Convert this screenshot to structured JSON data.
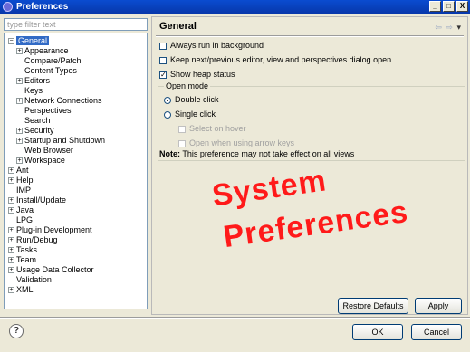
{
  "window": {
    "title": "Preferences",
    "minimize": "_",
    "maximize": "□",
    "close": "X"
  },
  "filter": {
    "placeholder": "type filter text"
  },
  "tree": {
    "expander": "+",
    "collapser": "−",
    "items": [
      {
        "label": "General"
      },
      {
        "label": "Appearance"
      },
      {
        "label": "Compare/Patch"
      },
      {
        "label": "Content Types"
      },
      {
        "label": "Editors"
      },
      {
        "label": "Keys"
      },
      {
        "label": "Network Connections"
      },
      {
        "label": "Perspectives"
      },
      {
        "label": "Search"
      },
      {
        "label": "Security"
      },
      {
        "label": "Startup and Shutdown"
      },
      {
        "label": "Web Browser"
      },
      {
        "label": "Workspace"
      },
      {
        "label": "Ant"
      },
      {
        "label": "Help"
      },
      {
        "label": "IMP"
      },
      {
        "label": "Install/Update"
      },
      {
        "label": "Java"
      },
      {
        "label": "LPG"
      },
      {
        "label": "Plug-in Development"
      },
      {
        "label": "Run/Debug"
      },
      {
        "label": "Tasks"
      },
      {
        "label": "Team"
      },
      {
        "label": "Usage Data Collector"
      },
      {
        "label": "Validation"
      },
      {
        "label": "XML"
      }
    ]
  },
  "page": {
    "heading": "General",
    "nav": {
      "back": "⇦",
      "forward": "⇨",
      "menu": "▾"
    },
    "options": {
      "run_background": "Always run in background",
      "keep_next_prev": "Keep next/previous editor, view and perspectives dialog open",
      "show_heap": "Show heap status"
    },
    "open_mode": {
      "title": "Open mode",
      "double_click": "Double click",
      "single_click": "Single click",
      "select_on_hover": "Select on hover",
      "open_arrow_keys": "Open when using arrow keys"
    },
    "note_label": "Note:",
    "note_text": "This preference may not take effect on all views",
    "restore_defaults": "Restore Defaults",
    "apply": "Apply"
  },
  "overlay": {
    "line1": "System",
    "line2": "Preferences",
    "color": "#ff1a1a"
  },
  "footer": {
    "help": "?",
    "ok": "OK",
    "cancel": "Cancel"
  }
}
